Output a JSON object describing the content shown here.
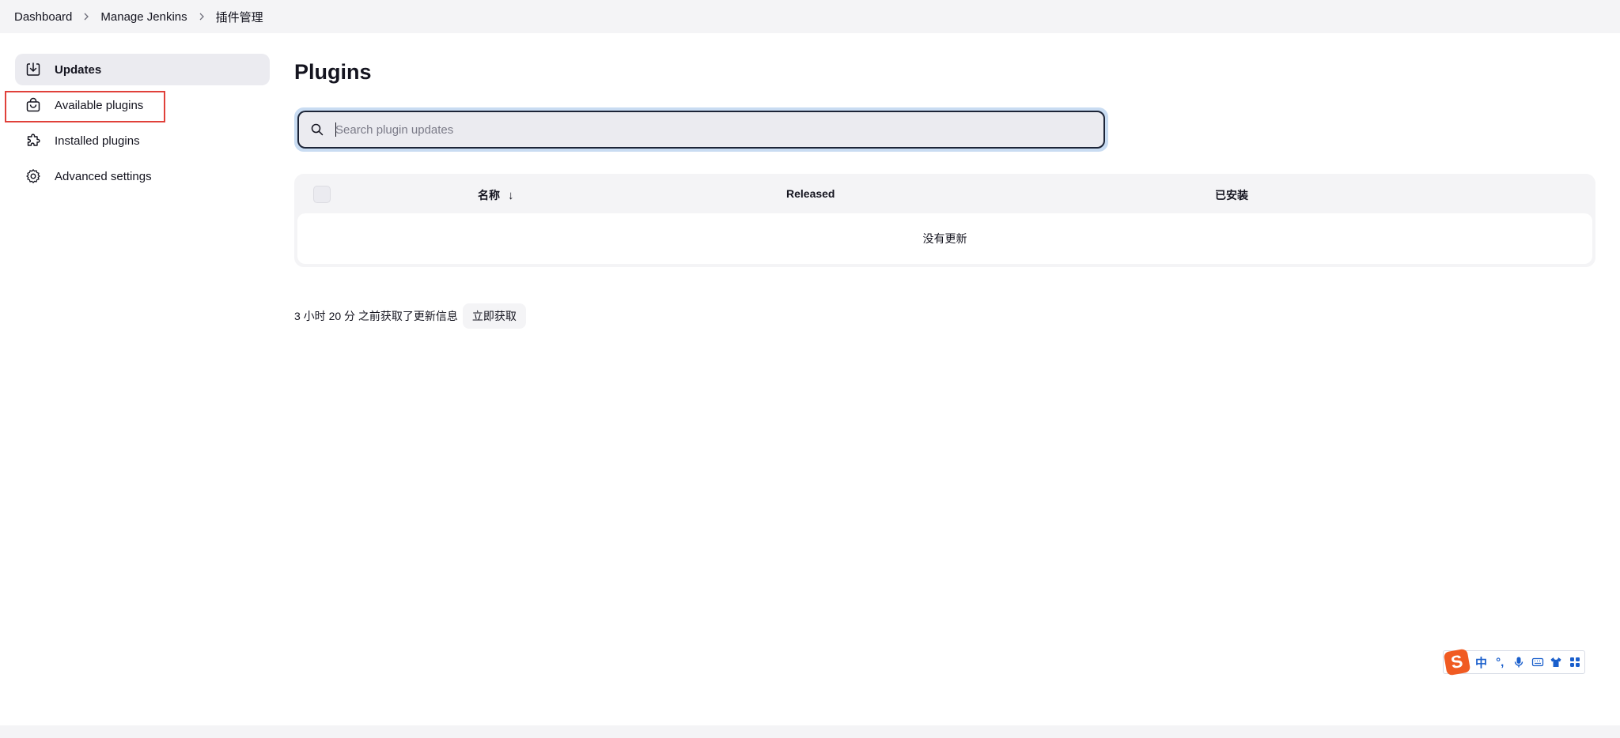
{
  "breadcrumb": {
    "items": [
      "Dashboard",
      "Manage Jenkins",
      "插件管理"
    ]
  },
  "sidebar": {
    "items": [
      {
        "label": "Updates",
        "icon": "download-icon",
        "active": true
      },
      {
        "label": "Available plugins",
        "icon": "shopping-bag-icon",
        "active": false
      },
      {
        "label": "Installed plugins",
        "icon": "puzzle-icon",
        "active": false
      },
      {
        "label": "Advanced settings",
        "icon": "gear-icon",
        "active": false
      }
    ]
  },
  "main": {
    "title": "Plugins",
    "search": {
      "placeholder": "Search plugin updates",
      "value": ""
    },
    "table": {
      "columns": [
        "名称",
        "Released",
        "已安装"
      ],
      "sort_indicator": "↓",
      "empty_message": "没有更新"
    },
    "update_info": {
      "text": "3 小时 20 分 之前获取了更新信息",
      "button_label": "立即获取"
    }
  },
  "ime_toolbar": {
    "logo": "S",
    "mode": "中",
    "punct": "°,",
    "icons": [
      "microphone-icon",
      "keyboard-icon",
      "shirt-icon",
      "apps-grid-icon"
    ]
  },
  "colors": {
    "accent_border": "#1c2437",
    "highlight_box": "#e0403a",
    "ime_brand": "#f05b22",
    "ime_icon": "#1a5fcc"
  }
}
